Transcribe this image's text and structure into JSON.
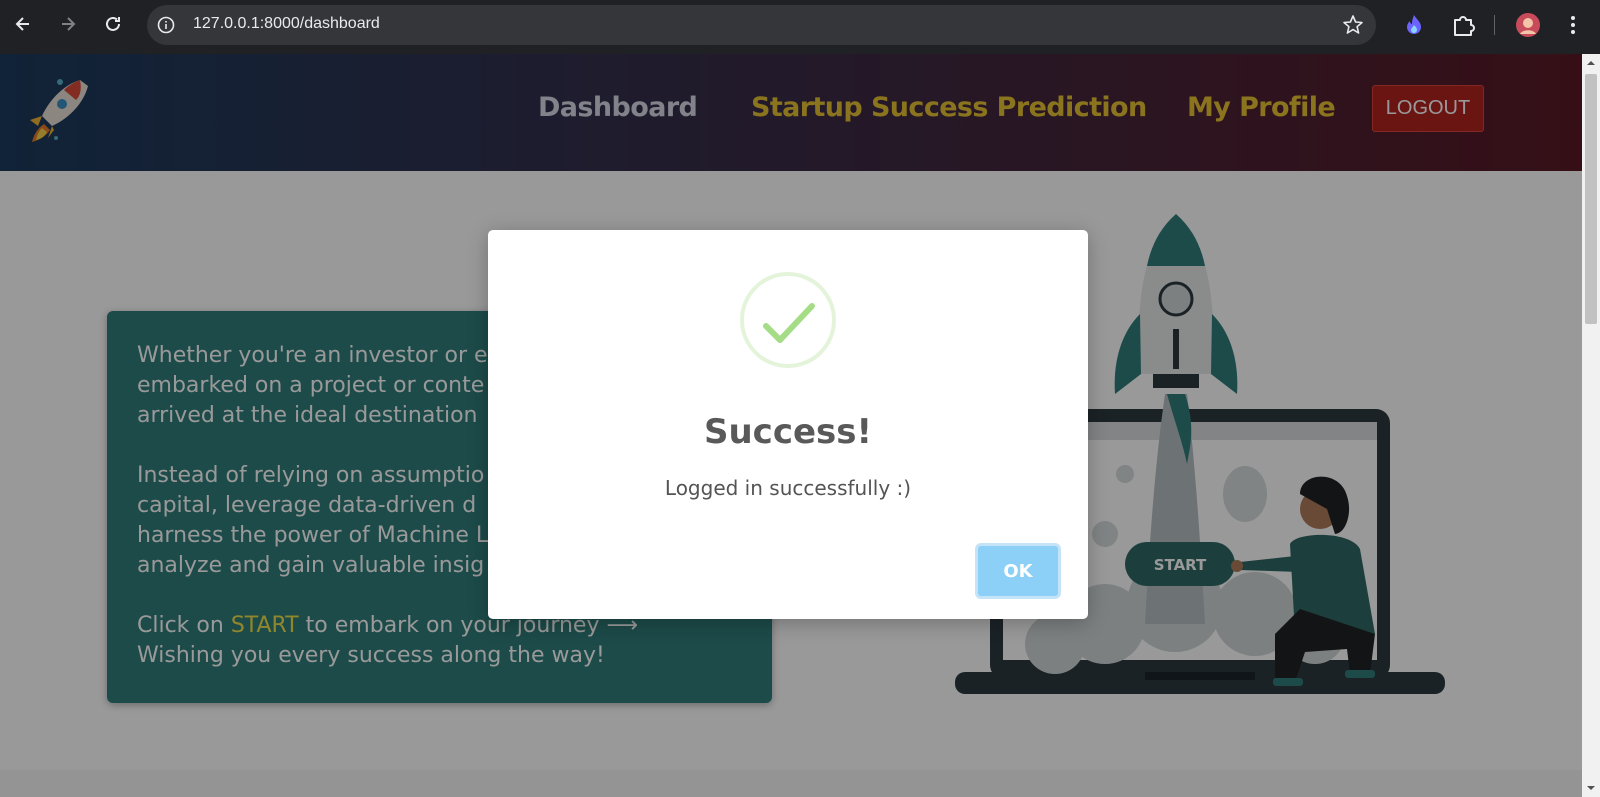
{
  "browser": {
    "url": "127.0.0.1:8000/dashboard"
  },
  "navbar": {
    "links": [
      {
        "label": "Dashboard",
        "active": true
      },
      {
        "label": "Startup Success Prediction",
        "active": false
      },
      {
        "label": "My Profile",
        "active": false
      }
    ],
    "logout_label": "LOGOUT"
  },
  "hero": {
    "paragraphs": [
      "Whether you're an investor or en",
      "embarked on a project or conte",
      "arrived at the ideal destination"
    ],
    "paragraph2": [
      "Instead of relying on assumptio",
      "capital, leverage data-driven d",
      "harness the power of Machine L",
      "analyze and gain valuable insig"
    ],
    "cta_prefix": "Click on ",
    "cta_keyword": "START",
    "cta_suffix": " to embark on your journey ⟶",
    "cta_line2": "Wishing you every success along the way!"
  },
  "illustration": {
    "button_label": "START"
  },
  "modal": {
    "title": "Success!",
    "message": "Logged in successfully :)",
    "ok_label": "OK"
  },
  "colors": {
    "accent_gold": "#e8c233",
    "logout_red": "#b3241f",
    "hero_teal": "#2f7d7a",
    "ok_blue": "#8ccff7",
    "success_green": "#a5dc86"
  }
}
